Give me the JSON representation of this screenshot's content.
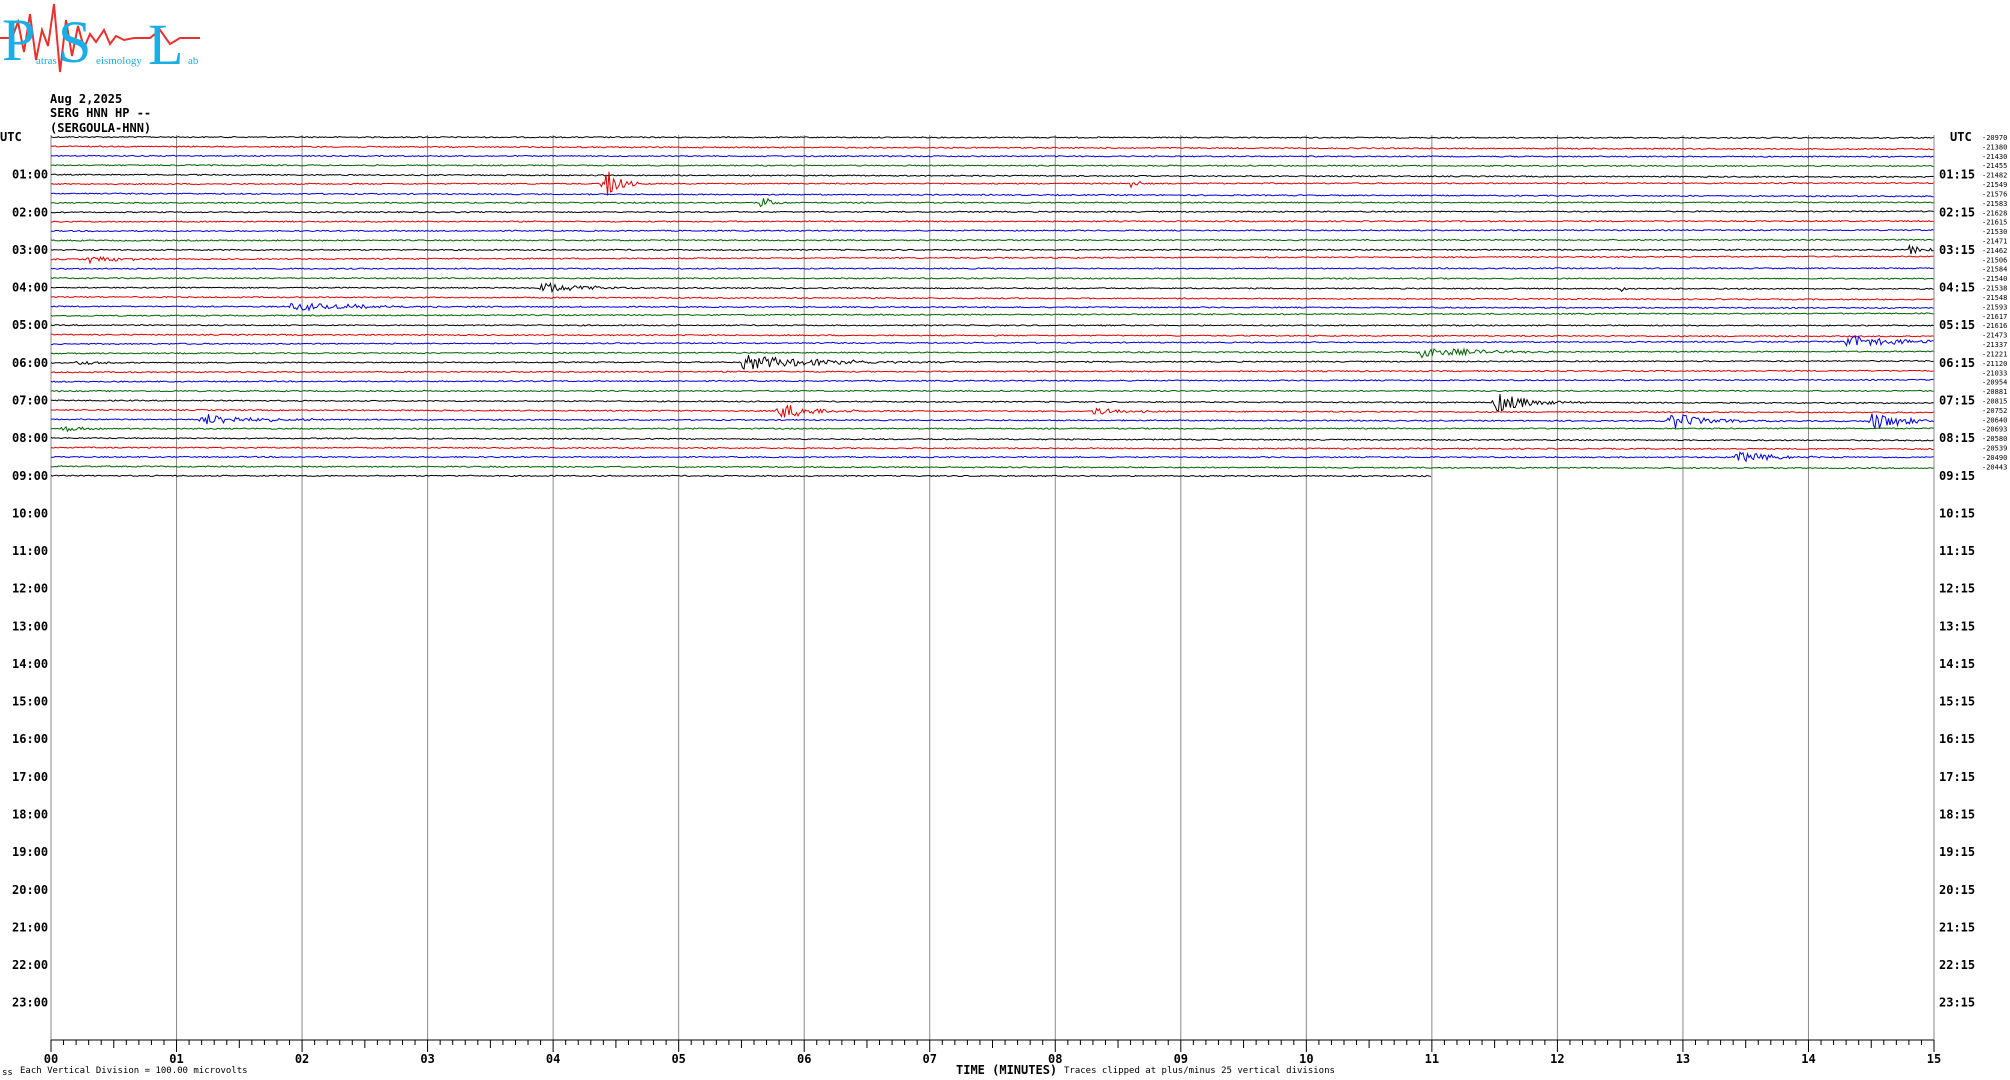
{
  "logo": {
    "letter_1": "P",
    "letter_2": "S",
    "letter_3": "L",
    "word_1": "atras",
    "word_2": "eismology",
    "word_3": "ab",
    "colors": {
      "letters": "#18aee6",
      "waveform": "#e8322e"
    }
  },
  "header": {
    "date": "Aug 2,2025",
    "station": "SERG HNN HP --",
    "name": "(SERGOULA-HNN)"
  },
  "footer": {
    "scale": "Each Vertical Division =  100.00 microvolts",
    "clip_note": "Traces clipped at plus/minus 25 vertical divisions",
    "corner": "ss"
  },
  "colors": {
    "trace_cycle": [
      "#000000",
      "#e00000",
      "#0000e0",
      "#006400"
    ],
    "grid": "#8a8a8a"
  },
  "chart_data": {
    "type": "line",
    "subtype": "helicorder",
    "xlabel": "TIME (MINUTES)",
    "x_ticks": [
      "00",
      "01",
      "02",
      "03",
      "04",
      "05",
      "06",
      "07",
      "08",
      "09",
      "10",
      "11",
      "12",
      "13",
      "14",
      "15"
    ],
    "xlim": [
      0,
      15
    ],
    "left_axis_title": "UTC",
    "right_axis_title": "UTC",
    "left_hour_labels": [
      "01:00",
      "02:00",
      "03:00",
      "04:00",
      "05:00",
      "06:00",
      "07:00",
      "08:00",
      "09:00",
      "10:00",
      "11:00",
      "12:00",
      "13:00",
      "14:00",
      "15:00",
      "16:00",
      "17:00",
      "18:00",
      "19:00",
      "20:00",
      "21:00",
      "22:00",
      "23:00"
    ],
    "right_hour_labels": [
      "01:15",
      "02:15",
      "03:15",
      "04:15",
      "05:15",
      "06:15",
      "07:15",
      "08:15",
      "09:15",
      "10:15",
      "11:15",
      "12:15",
      "13:15",
      "14:15",
      "15:15",
      "16:15",
      "17:15",
      "18:15",
      "19:15",
      "20:15",
      "21:15",
      "22:15",
      "23:15"
    ],
    "trace_count": 96,
    "traces_recorded": 37,
    "last_trace_end_minute": 11,
    "trace_offsets": [
      -20970,
      -21380,
      -21430,
      -21455,
      -21482,
      -21549,
      -21576,
      -21583,
      -21628,
      -21615,
      -21530,
      -21471,
      -21462,
      -21506,
      -21584,
      -21540,
      -21538,
      -21548,
      -21593,
      -21617,
      -21616,
      -21473,
      -21337,
      -21221,
      -21120,
      -21033,
      -20954,
      -20881,
      -20815,
      -20752,
      -20640,
      -20693,
      -20580,
      -20539,
      -20490,
      -20443
    ],
    "events": [
      {
        "trace": 5,
        "minute": 4.4,
        "amplitude": 20,
        "duration": 0.3
      },
      {
        "trace": 5,
        "minute": 8.6,
        "amplitude": 5,
        "duration": 0.2
      },
      {
        "trace": 7,
        "minute": 5.65,
        "amplitude": 9,
        "duration": 0.2
      },
      {
        "trace": 12,
        "minute": 14.8,
        "amplitude": 5,
        "duration": 0.4
      },
      {
        "trace": 13,
        "minute": 0.3,
        "amplitude": 4,
        "duration": 0.8
      },
      {
        "trace": 16,
        "minute": 3.9,
        "amplitude": 6,
        "duration": 0.9
      },
      {
        "trace": 16,
        "minute": 12.5,
        "amplitude": 4,
        "duration": 0.1
      },
      {
        "trace": 18,
        "minute": 1.9,
        "amplitude": 4,
        "duration": 1.8
      },
      {
        "trace": 24,
        "minute": 5.5,
        "amplitude": 8,
        "duration": 1.8
      },
      {
        "trace": 24,
        "minute": 0.2,
        "amplitude": 3,
        "duration": 0.5
      },
      {
        "trace": 23,
        "minute": 10.9,
        "amplitude": 6,
        "duration": 1.2
      },
      {
        "trace": 22,
        "minute": 14.3,
        "amplitude": 7,
        "duration": 1.0
      },
      {
        "trace": 28,
        "minute": 11.5,
        "amplitude": 10,
        "duration": 0.8
      },
      {
        "trace": 29,
        "minute": 5.8,
        "amplitude": 9,
        "duration": 0.7
      },
      {
        "trace": 29,
        "minute": 8.3,
        "amplitude": 4,
        "duration": 0.6
      },
      {
        "trace": 30,
        "minute": 1.2,
        "amplitude": 6,
        "duration": 1.2
      },
      {
        "trace": 30,
        "minute": 12.9,
        "amplitude": 9,
        "duration": 0.8
      },
      {
        "trace": 30,
        "minute": 14.5,
        "amplitude": 10,
        "duration": 0.7
      },
      {
        "trace": 31,
        "minute": 0.1,
        "amplitude": 5,
        "duration": 0.3
      },
      {
        "trace": 34,
        "minute": 13.4,
        "amplitude": 6,
        "duration": 1.0
      }
    ]
  }
}
